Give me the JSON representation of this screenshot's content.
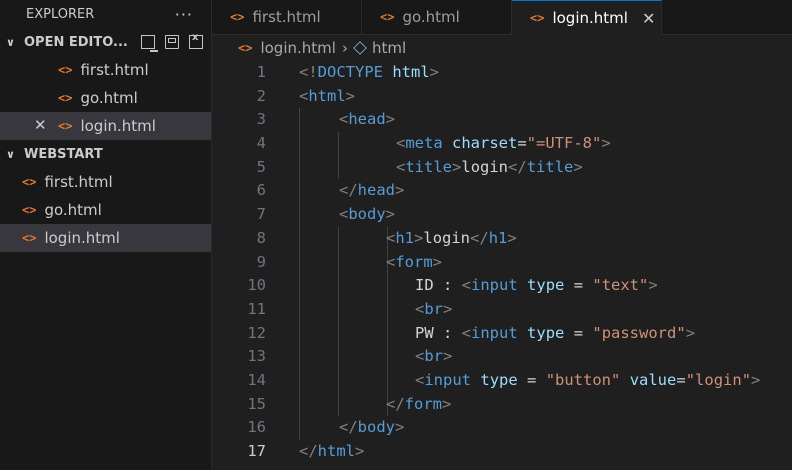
{
  "explorer": {
    "title": "EXPLORER",
    "more": "···",
    "open_editors": {
      "label": "OPEN EDITO...",
      "items": [
        {
          "name": "first.html",
          "selected": false
        },
        {
          "name": "go.html",
          "selected": false
        },
        {
          "name": "login.html",
          "selected": true
        }
      ]
    },
    "workspace": {
      "label": "WEBSTART",
      "items": [
        {
          "name": "first.html",
          "selected": false
        },
        {
          "name": "go.html",
          "selected": false
        },
        {
          "name": "login.html",
          "selected": true
        }
      ]
    }
  },
  "tabs": [
    {
      "label": "first.html",
      "active": false
    },
    {
      "label": "go.html",
      "active": false
    },
    {
      "label": "login.html",
      "active": true
    }
  ],
  "breadcrumb": {
    "file": "login.html",
    "symbol": "html"
  },
  "editor": {
    "current_line": 17,
    "lines": [
      {
        "n": "1",
        "indent": 0,
        "tokens": [
          [
            "t",
            "<!"
          ],
          [
            "tn",
            "DOCTYPE"
          ],
          [
            "tx",
            " "
          ],
          [
            "an",
            "html"
          ],
          [
            "t",
            ">"
          ]
        ]
      },
      {
        "n": "2",
        "indent": 0,
        "tokens": [
          [
            "t",
            "<"
          ],
          [
            "tn",
            "html"
          ],
          [
            "t",
            ">"
          ]
        ]
      },
      {
        "n": "3",
        "indent": 1,
        "tokens": [
          [
            "t",
            "<"
          ],
          [
            "tn",
            "head"
          ],
          [
            "t",
            ">"
          ]
        ]
      },
      {
        "n": "4",
        "indent": 2,
        "tokens": [
          [
            "t",
            "<"
          ],
          [
            "tn",
            "meta"
          ],
          [
            "tx",
            " "
          ],
          [
            "an",
            "charset"
          ],
          [
            "tx",
            "="
          ],
          [
            "av",
            "\"=UTF-8\""
          ],
          [
            "t",
            ">"
          ]
        ]
      },
      {
        "n": "5",
        "indent": 2,
        "tokens": [
          [
            "t",
            "<"
          ],
          [
            "tn",
            "title"
          ],
          [
            "t",
            ">"
          ],
          [
            "tx",
            "login"
          ],
          [
            "t",
            "</"
          ],
          [
            "tn",
            "title"
          ],
          [
            "t",
            ">"
          ]
        ]
      },
      {
        "n": "6",
        "indent": 1,
        "tokens": [
          [
            "t",
            "</"
          ],
          [
            "tn",
            "head"
          ],
          [
            "t",
            ">"
          ]
        ]
      },
      {
        "n": "7",
        "indent": 1,
        "tokens": [
          [
            "t",
            "<"
          ],
          [
            "tn",
            "body"
          ],
          [
            "t",
            ">"
          ]
        ]
      },
      {
        "n": "8",
        "indent": 3,
        "tokens": [
          [
            "t",
            "<"
          ],
          [
            "tn",
            "h1"
          ],
          [
            "t",
            ">"
          ],
          [
            "tx",
            "login"
          ],
          [
            "t",
            "</"
          ],
          [
            "tn",
            "h1"
          ],
          [
            "t",
            ">"
          ]
        ]
      },
      {
        "n": "9",
        "indent": 3,
        "tokens": [
          [
            "t",
            "<"
          ],
          [
            "tn",
            "form"
          ],
          [
            "t",
            ">"
          ]
        ]
      },
      {
        "n": "10",
        "indent": 4,
        "tokens": [
          [
            "tx",
            "ID : "
          ],
          [
            "t",
            "<"
          ],
          [
            "tn",
            "input"
          ],
          [
            "tx",
            " "
          ],
          [
            "an",
            "type"
          ],
          [
            "tx",
            " = "
          ],
          [
            "av",
            "\"text\""
          ],
          [
            "t",
            ">"
          ]
        ]
      },
      {
        "n": "11",
        "indent": 4,
        "tokens": [
          [
            "t",
            "<"
          ],
          [
            "tn",
            "br"
          ],
          [
            "t",
            ">"
          ]
        ]
      },
      {
        "n": "12",
        "indent": 4,
        "tokens": [
          [
            "tx",
            "PW : "
          ],
          [
            "t",
            "<"
          ],
          [
            "tn",
            "input"
          ],
          [
            "tx",
            " "
          ],
          [
            "an",
            "type"
          ],
          [
            "tx",
            " = "
          ],
          [
            "av",
            "\"password\""
          ],
          [
            "t",
            ">"
          ]
        ]
      },
      {
        "n": "13",
        "indent": 4,
        "tokens": [
          [
            "t",
            "<"
          ],
          [
            "tn",
            "br"
          ],
          [
            "t",
            ">"
          ]
        ]
      },
      {
        "n": "14",
        "indent": 4,
        "tokens": [
          [
            "t",
            "<"
          ],
          [
            "tn",
            "input"
          ],
          [
            "tx",
            " "
          ],
          [
            "an",
            "type"
          ],
          [
            "tx",
            " = "
          ],
          [
            "av",
            "\"button\""
          ],
          [
            "tx",
            " "
          ],
          [
            "an",
            "value"
          ],
          [
            "tx",
            "="
          ],
          [
            "av",
            "\"login\""
          ],
          [
            "t",
            ">"
          ]
        ]
      },
      {
        "n": "15",
        "indent": 3,
        "tokens": [
          [
            "t",
            "</"
          ],
          [
            "tn",
            "form"
          ],
          [
            "t",
            ">"
          ]
        ]
      },
      {
        "n": "16",
        "indent": 1,
        "tokens": [
          [
            "t",
            "</"
          ],
          [
            "tn",
            "body"
          ],
          [
            "t",
            ">"
          ]
        ]
      },
      {
        "n": "17",
        "indent": 0,
        "tokens": [
          [
            "t",
            "</"
          ],
          [
            "tn",
            "html"
          ],
          [
            "t",
            ">"
          ]
        ]
      }
    ]
  },
  "colors": {
    "tag_bracket": "#808080",
    "tag_name": "#569cd6",
    "attr_name": "#9cdcfe",
    "attr_value": "#ce9178",
    "file_icon": "#e37933",
    "active_tab_border": "#0078d4"
  },
  "icons": {
    "file_icon": "<>",
    "chevron": "chevron-down-icon",
    "close": "close-icon",
    "breadcrumb_symbol": "symbol-class-icon"
  }
}
